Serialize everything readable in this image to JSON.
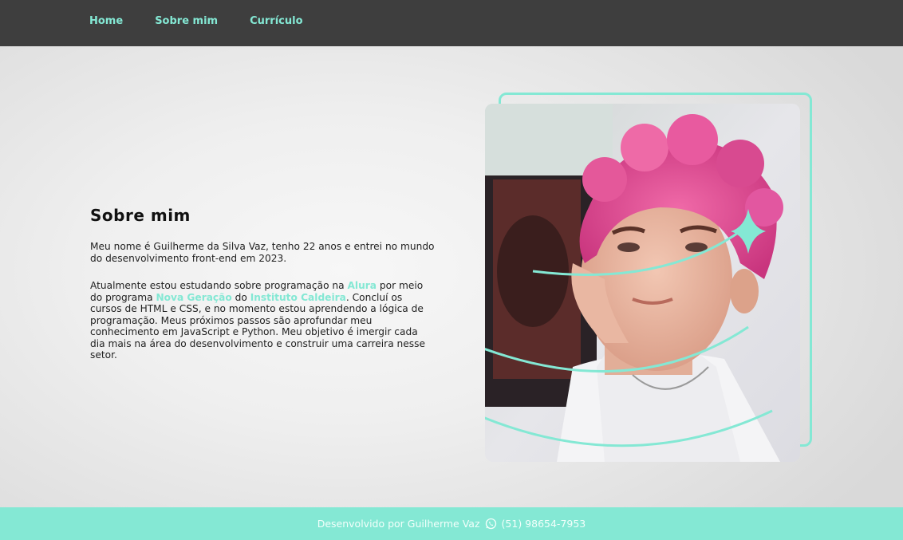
{
  "nav": {
    "home": "Home",
    "about": "Sobre mim",
    "resume": "Currículo"
  },
  "about": {
    "title": "Sobre mim",
    "p1": "Meu nome é Guilherme da Silva Vaz, tenho 22 anos e entrei no mundo do desenvolvimento front-end em 2023.",
    "p2_a": "Atualmente estou estudando sobre programação na ",
    "p2_alura": "Alura",
    "p2_b": " por meio do programa ",
    "p2_nova": "Nova Geração",
    "p2_c": " do ",
    "p2_inst": "Instituto Caldeira",
    "p2_d": ". Concluí os cursos de HTML e CSS, e no momento estou aprendendo a lógica de programação. Meus próximos passos são aprofundar meu conhecimento em JavaScript e Python. Meu objetivo é imergir cada dia mais na área do desenvolvimento e construir uma carreira nesse setor."
  },
  "footer": {
    "credit": "Desenvolvido por Guilherme Vaz",
    "phone": "(51) 98654-7953",
    "icon": "whatsapp-icon"
  },
  "colors": {
    "accent": "#84e8d4",
    "header_bg": "#3e3e3e"
  }
}
